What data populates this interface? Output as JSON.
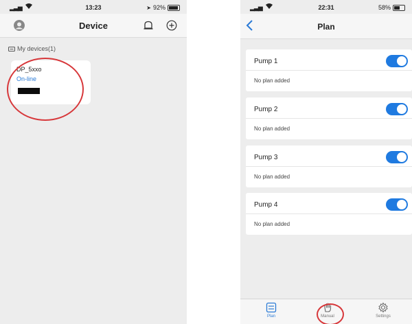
{
  "left": {
    "status": {
      "time": "13:23",
      "battery": "92%",
      "battery_level": 0.92
    },
    "header": {
      "title": "Device"
    },
    "section_label": "My devices(1)",
    "device": {
      "name": "DP_5xxo",
      "status": "On-line"
    }
  },
  "right": {
    "status": {
      "time": "22:31",
      "battery": "58%",
      "battery_level": 0.58
    },
    "header": {
      "title": "Plan"
    },
    "pumps": [
      {
        "name": "Pump 1",
        "plan_text": "No plan added",
        "enabled": true
      },
      {
        "name": "Pump 2",
        "plan_text": "No plan added",
        "enabled": true
      },
      {
        "name": "Pump 3",
        "plan_text": "No plan added",
        "enabled": true
      },
      {
        "name": "Pump 4",
        "plan_text": "No plan added",
        "enabled": true
      }
    ],
    "tabs": [
      {
        "label": "Plan",
        "icon": "list-icon",
        "active": true
      },
      {
        "label": "Manual",
        "icon": "hand-icon",
        "active": false
      },
      {
        "label": "Settings",
        "icon": "gear-icon",
        "active": false
      }
    ]
  },
  "colors": {
    "accent": "#1f7ae0",
    "annotation_red": "#d7373a",
    "online": "#2a7ad6"
  }
}
